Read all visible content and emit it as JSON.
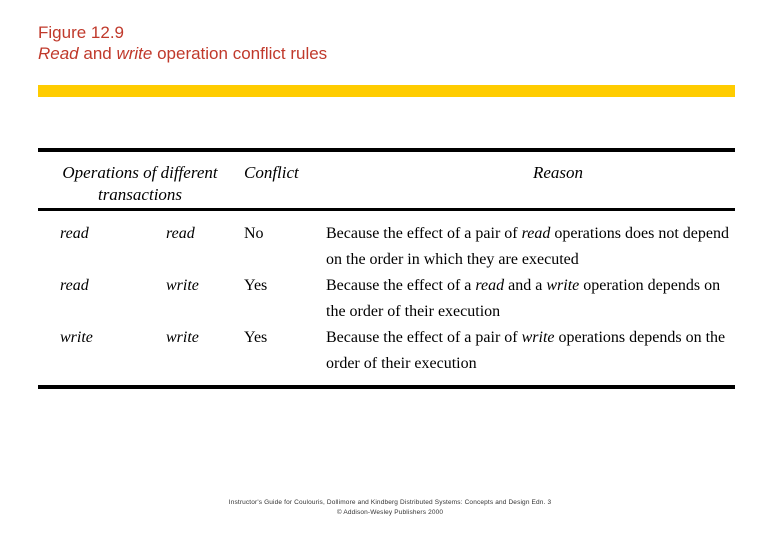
{
  "slide": {
    "title": {
      "figure_number": "Figure 12.9",
      "subtitle_prefix": "",
      "subtitle_word1": "Read",
      "subtitle_mid": " and ",
      "subtitle_word2": "write",
      "subtitle_suffix": " operation conflict rules"
    },
    "accent_color": "#ffcc00",
    "title_color": "#c0392b"
  },
  "table": {
    "headers": {
      "col1_line1": "Operations of different",
      "col1_line2": "transactions",
      "col2": "Conflict",
      "col3": "Reason"
    },
    "rows": [
      {
        "op1": "read",
        "op2": "read",
        "conflict": "No",
        "reason_part1": "Because the effect of a pair of ",
        "reason_em1": "read",
        "reason_part2": " operations does not depend on the order in which they are executed",
        "reason_em2": "",
        "reason_part3": ""
      },
      {
        "op1": "read",
        "op2": "write",
        "conflict": "Yes",
        "reason_part1": "Because the effect of a ",
        "reason_em1": "read",
        "reason_part2": " and a ",
        "reason_em2": "write",
        "reason_part3": " operation depends on the order of their execution"
      },
      {
        "op1": "write",
        "op2": "write",
        "conflict": "Yes",
        "reason_part1": "Because the effect of a pair of ",
        "reason_em1": "write",
        "reason_part2": " operations depends on the order of their execution",
        "reason_em2": "",
        "reason_part3": ""
      }
    ]
  },
  "footer": {
    "line1": "Instructor's Guide for  Coulouris, Dollimore and Kindberg   Distributed Systems: Concepts and Design   Edn. 3",
    "line2": "© Addison-Wesley Publishers 2000"
  }
}
